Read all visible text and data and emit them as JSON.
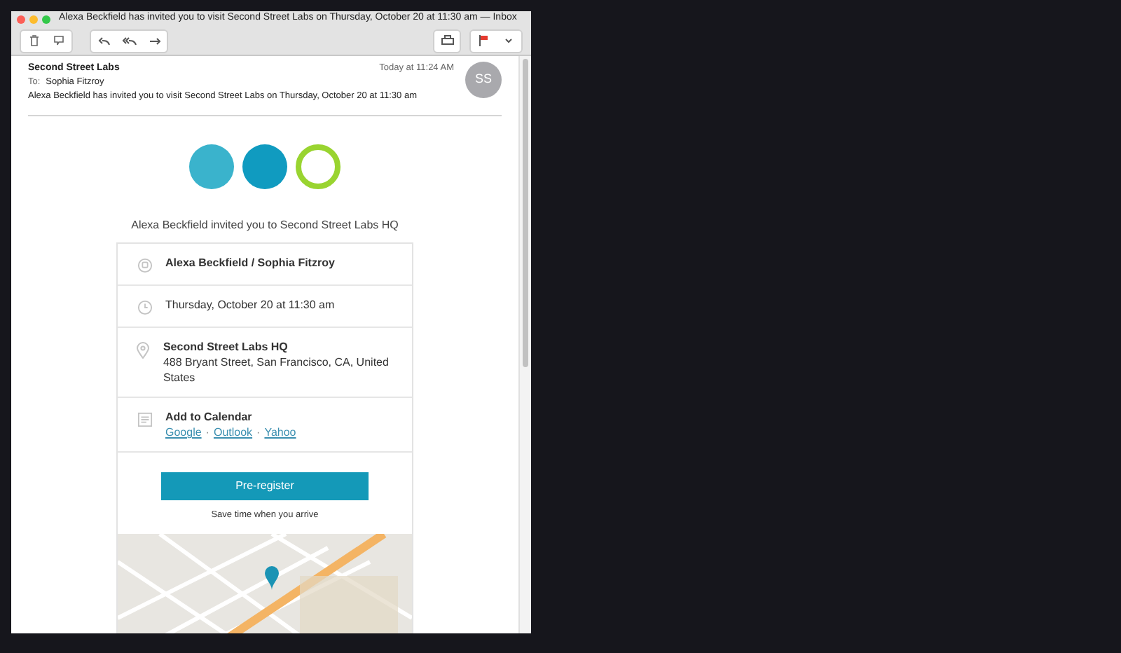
{
  "window": {
    "title": "Alexa Beckfield has invited you to visit Second Street Labs on Thursday, October 20 at 11:30 am — Inbox"
  },
  "message": {
    "sender": "Second Street Labs",
    "time": "Today at 11:24 AM",
    "to_label": "To:",
    "to": "Sophia Fitzroy",
    "subject": "Alexa Beckfield has invited you to visit Second Street Labs on Thursday, October 20 at 11:30 am",
    "avatar": "SS"
  },
  "logo_circles": [
    {
      "color": "#3ab3cc",
      "kind": "filled"
    },
    {
      "color": "#109bc0",
      "kind": "filled"
    },
    {
      "color": "#99d430",
      "kind": "ring"
    }
  ],
  "invite_line": "Alexa Beckfield invited you to Second Street Labs HQ",
  "details": [
    {
      "kind": "people",
      "title": "Alexa Beckfield / Sophia Fitzroy"
    },
    {
      "kind": "time",
      "text": "Thursday, October 20 at 11:30 am"
    },
    {
      "kind": "location",
      "title": "Second Street Labs HQ",
      "text": "488 Bryant Street, San Francisco, CA, United States"
    },
    {
      "kind": "calendar",
      "title": "Add to Calendar",
      "links": [
        "Google",
        "Outlook",
        "Yahoo"
      ],
      "separator": "·"
    }
  ],
  "preregister": {
    "button": "Pre-register",
    "note": "Save time when you arrive"
  }
}
